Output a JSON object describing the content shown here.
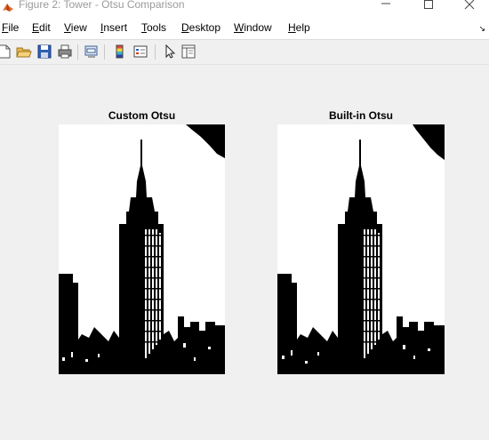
{
  "window": {
    "title": "Figure 2: Tower - Otsu Comparison",
    "app_icon": "matlab-icon",
    "controls": [
      "minimize-icon",
      "maximize-icon",
      "close-icon"
    ]
  },
  "menubar": {
    "items": [
      {
        "mnemonic": "F",
        "rest": "ile"
      },
      {
        "mnemonic": "E",
        "rest": "dit"
      },
      {
        "mnemonic": "V",
        "rest": "iew"
      },
      {
        "mnemonic": "I",
        "rest": "nsert"
      },
      {
        "mnemonic": "T",
        "rest": "ools"
      },
      {
        "mnemonic": "D",
        "rest": "esktop"
      },
      {
        "mnemonic": "W",
        "rest": "indow"
      },
      {
        "mnemonic": "H",
        "rest": "elp"
      }
    ]
  },
  "toolbar": {
    "buttons": [
      "new-figure-icon",
      "open-file-icon",
      "save-icon",
      "print-icon",
      "link-plot-icon",
      "insert-colorbar-icon",
      "insert-legend-icon",
      "edit-plot-arrow-icon",
      "property-inspector-icon"
    ]
  },
  "figure": {
    "panels": [
      {
        "title": "Custom Otsu",
        "image": "binarized-tower-image"
      },
      {
        "title": "Built-in Otsu",
        "image": "binarized-tower-image"
      }
    ]
  },
  "colors": {
    "figure_bg": "#f0f0f0",
    "image_black": "#000000",
    "image_white": "#ffffff"
  }
}
